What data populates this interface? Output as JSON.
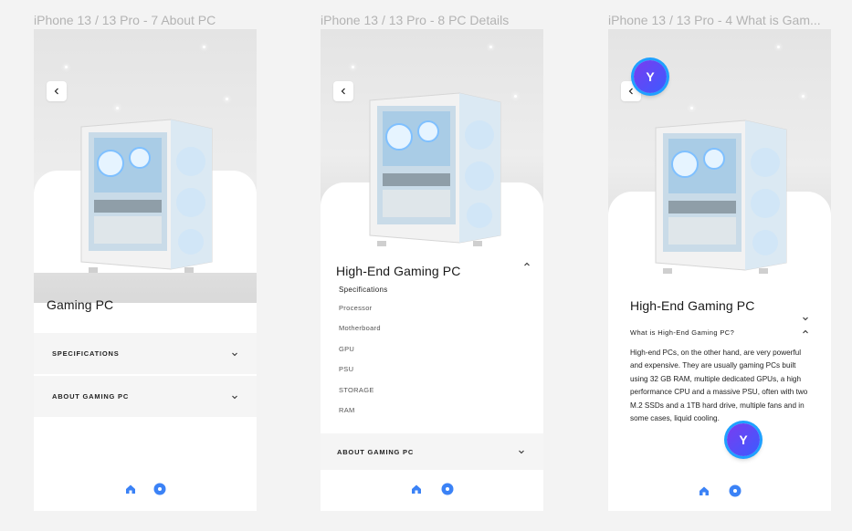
{
  "frames": [
    {
      "frame_title": "iPhone 13 / 13 Pro - 7 About PC",
      "title": "Gaming PC",
      "accordions": [
        {
          "label": "SPECIFICATIONS"
        },
        {
          "label": "ABOUT GAMING PC"
        }
      ]
    },
    {
      "frame_title": "iPhone 13 / 13 Pro - 8 PC Details",
      "title": "High-End Gaming PC",
      "spec_heading": "Specifications",
      "spec_items": [
        "Processor",
        "Motherboard",
        "GPU",
        "PSU",
        "STORAGE",
        "RAM"
      ],
      "accordion": {
        "label": "ABOUT GAMING PC"
      }
    },
    {
      "frame_title": "iPhone 13 / 13 Pro - 4 What is Gam...",
      "title": "High-End Gaming PC",
      "question": "What is High-End Gaming PC?",
      "answer": "High-end PCs, on the other hand, are very powerful and expensive. They are usually gaming PCs built using 32 GB RAM, multiple dedicated GPUs, a high performance CPU and a massive PSU, often with two M.2 SSDs and a 1TB hard drive, multiple fans and in some cases, liquid cooling.",
      "avatar_letter": "Y",
      "avatar_letter_2": "Y"
    }
  ],
  "icons": {
    "back": "chevron-left-icon",
    "expand": "chevron-down-icon",
    "collapse": "chevron-up-icon",
    "home": "home-icon",
    "profile": "circle-dot-icon"
  },
  "colors": {
    "accent": "#3b82f6",
    "background": "#f3f3f3",
    "row_bg": "#f5f5f5",
    "avatar_start": "#7a3cf0",
    "avatar_end": "#3b5bff"
  }
}
